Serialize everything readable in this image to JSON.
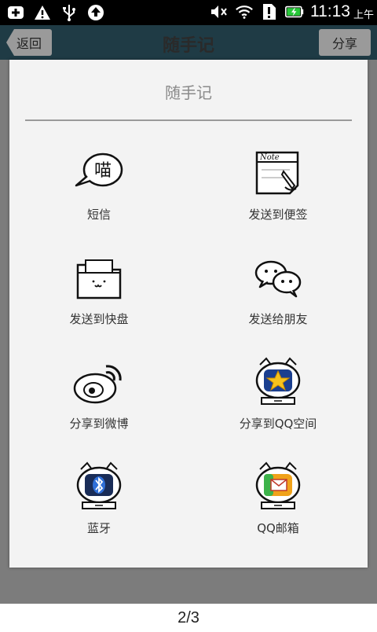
{
  "status_bar": {
    "time": "11:13",
    "ampm": "上午"
  },
  "app_bar": {
    "back_label": "返回",
    "title": "随手记",
    "share_label": "分享"
  },
  "dialog": {
    "title": "随手记",
    "items": [
      {
        "label": "短信",
        "icon": "speech-bubble-icon"
      },
      {
        "label": "发送到便签",
        "icon": "note-icon"
      },
      {
        "label": "发送到快盘",
        "icon": "folder-icon"
      },
      {
        "label": "发送给朋友",
        "icon": "chat-bubbles-icon"
      },
      {
        "label": "分享到微博",
        "icon": "weibo-icon"
      },
      {
        "label": "分享到QQ空间",
        "icon": "qzone-icon"
      },
      {
        "label": "蓝牙",
        "icon": "bluetooth-icon"
      },
      {
        "label": "QQ邮箱",
        "icon": "qq-mail-icon"
      }
    ]
  },
  "footer": {
    "page_indicator": "2/3"
  }
}
